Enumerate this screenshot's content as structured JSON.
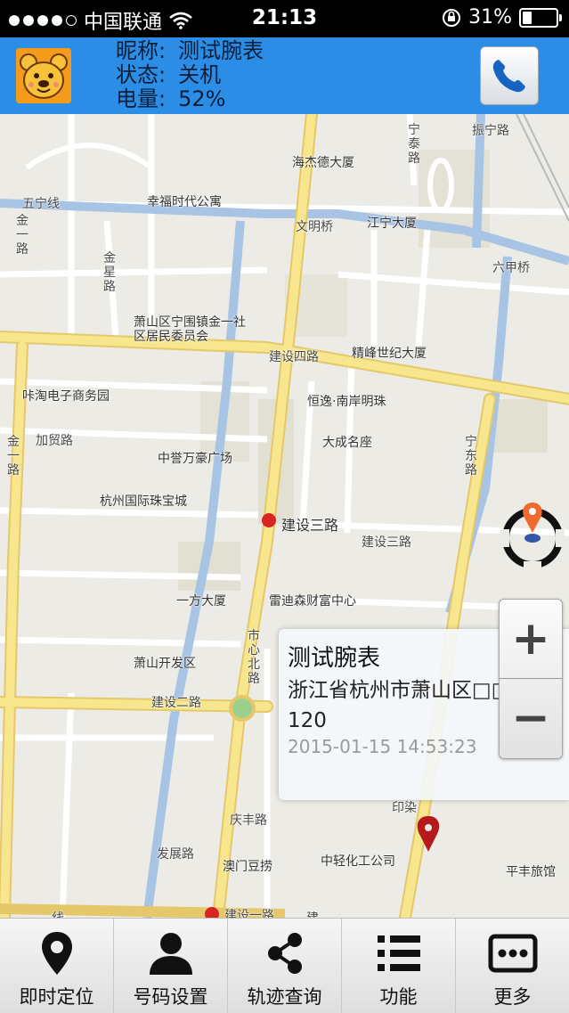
{
  "status_bar": {
    "carrier": "中国联通",
    "time": "21:13",
    "battery": "31%",
    "battery_level": 0.31
  },
  "header": {
    "nickname_label": "昵称:",
    "nickname": "测试腕表",
    "status_label": "状态:",
    "status": "关机",
    "battery_label": "电量:",
    "battery": "52%"
  },
  "map": {
    "labels": {
      "haijiede": "海杰德大厦",
      "xingfu": "幸福时代公寓",
      "jiangning": "江宁大厦",
      "wenming": "文明桥",
      "wuning": "五宁线",
      "ningtai": "宁泰路",
      "zhenning": "振宁路",
      "liujia": "六甲桥",
      "jinyi": "金一路",
      "jinxing": "金星路",
      "juweihui": "萧山区宁围镇金一社区居民委员会",
      "jianshe4": "建设四路",
      "jingfeng": "精峰世纪大厦",
      "xiantao": "咔淘电子商务园",
      "hengyi": "恒逸·南岸明珠",
      "jiamao": "加贸路",
      "dacheng": "大成名座",
      "ningdong": "宁东路",
      "zhongyu": "中誉万豪广场",
      "jinyi2": "金一路",
      "zhubao": "杭州国际珠宝城",
      "jianshe3": "建设三路",
      "jianshe3b": "建设三路",
      "yifang": "一方大厦",
      "leidisen": "雷迪森财富中心",
      "shixin": "市心北路",
      "kaifaqu": "萧山开发区",
      "jianshe2": "建设二路",
      "qingfeng": "庆丰路",
      "fazhan": "发展路",
      "aomen": "澳门豆捞",
      "zhongqing": "中轻化工公司",
      "pingfeng": "平丰旅馆",
      "jianshe1": "建设一路",
      "yinye": "印染",
      "xian": "线",
      "jian": "建"
    }
  },
  "popup": {
    "title": "测试腕表",
    "address": "浙江省杭州市萧山区□□路120",
    "time": "2015-01-15 14:53:23"
  },
  "zoom": {
    "plus": "+",
    "minus": "−"
  },
  "tabs": [
    {
      "label": "即时定位",
      "icon": "location-pin-icon"
    },
    {
      "label": "号码设置",
      "icon": "person-icon"
    },
    {
      "label": "轨迹查询",
      "icon": "share-icon"
    },
    {
      "label": "功能",
      "icon": "list-icon"
    },
    {
      "label": "更多",
      "icon": "more-icon"
    }
  ],
  "colors": {
    "header_bg": "#2b8de6",
    "major_road": "#f6e58a",
    "river": "#a7c4e4"
  }
}
